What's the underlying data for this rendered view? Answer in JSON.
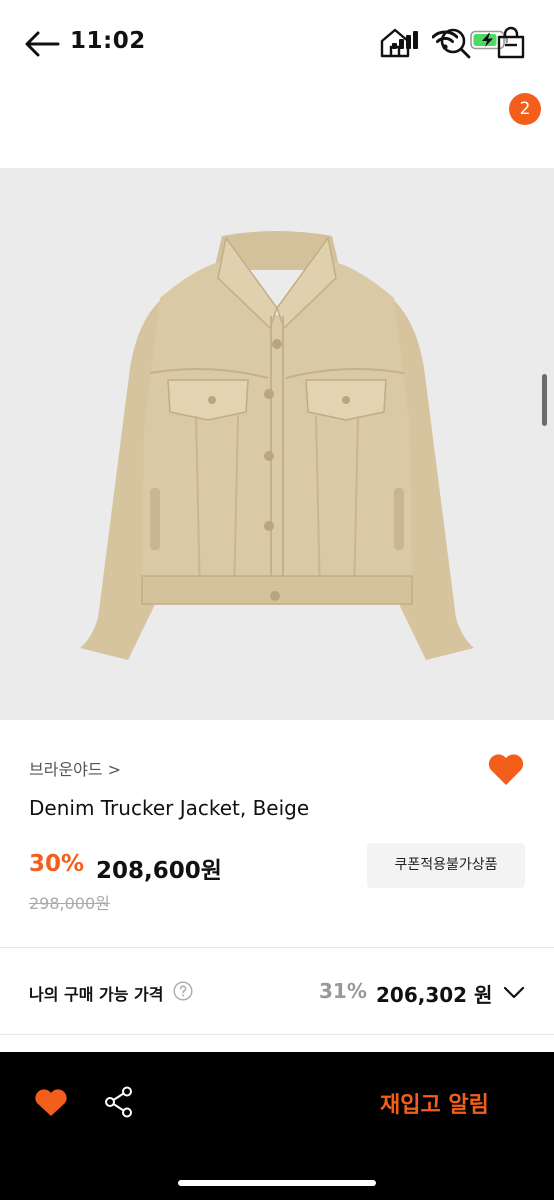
{
  "status_bar": {
    "time": "11:02",
    "battery_color": "#4cd964"
  },
  "header": {
    "cart_count": "2",
    "icons": [
      "back-arrow-icon",
      "home-icon",
      "search-icon",
      "shopping-bag-icon"
    ]
  },
  "product": {
    "brand": "브라운야드 >",
    "name": "Denim Trucker Jacket, Beige",
    "discount_rate": "30%",
    "sale_price": "208,600원",
    "original_price": "298,000원",
    "coupon_notice": "쿠폰적용불가상품",
    "wishlisted": true
  },
  "my_price": {
    "label": "나의 구매 가능 가격",
    "rate": "31%",
    "amount": "206,302 원"
  },
  "bottom_bar": {
    "restock_label": "재입고 알림"
  },
  "colors": {
    "accent": "#f35f1a",
    "image_background": "#ebebeb",
    "jacket": "#d8c7a2"
  }
}
